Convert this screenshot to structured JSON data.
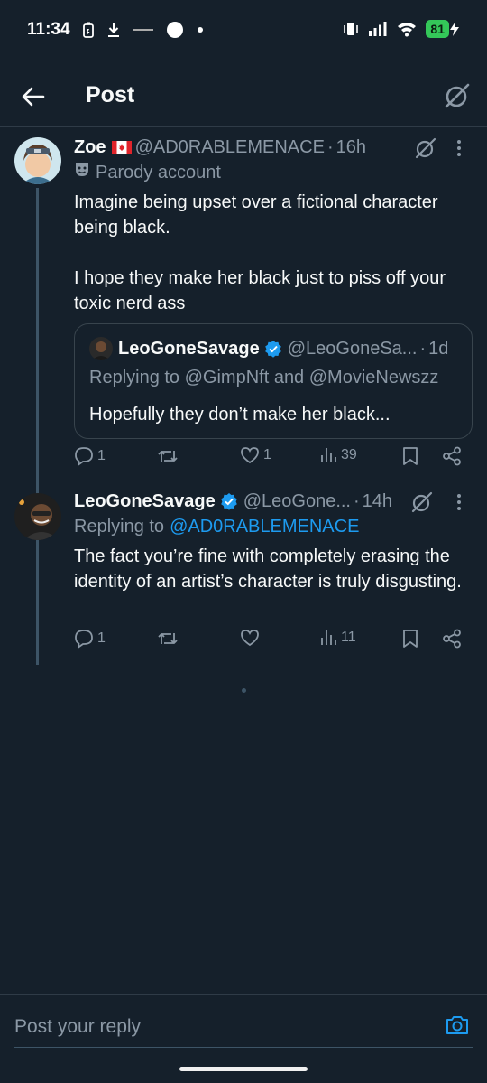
{
  "status_bar": {
    "time": "11:34",
    "battery": "81",
    "icons": [
      "sim-icon",
      "download-icon",
      "app-notification-icon",
      "circle-icon",
      "dot-icon",
      "vibrate-icon",
      "signal-icon",
      "wifi-icon",
      "battery-icon"
    ]
  },
  "header": {
    "title": "Post",
    "back_icon": "arrow-left-icon",
    "action_icon": "grok-icon"
  },
  "tweets": [
    {
      "display_name": "Zoe",
      "flag": "🇨🇦",
      "handle": "@AD0RABLEMENACE",
      "time": "16h",
      "sub_label": "Parody account",
      "text": "Imagine being upset over a fictional character being black.\n\nI hope they make her black just to piss off your toxic nerd ass",
      "quote": {
        "display_name": "LeoGoneSavage",
        "handle": "@LeoGoneSa...",
        "time": "1d",
        "replying_to": "Replying to @GimpNft and @MovieNewszz",
        "text": "Hopefully they don’t make her black..."
      },
      "actions": {
        "replies": "1",
        "reposts": "",
        "likes": "1",
        "views": "39"
      }
    },
    {
      "display_name": "LeoGoneSavage",
      "handle": "@LeoGone...",
      "time": "14h",
      "replying_prefix": "Replying to",
      "replying_to": "@AD0RABLEMENACE",
      "text": "The fact you’re fine with completely erasing the identity of an artist’s character is truly disgusting.",
      "actions": {
        "replies": "1",
        "reposts": "",
        "likes": "",
        "views": "11"
      }
    }
  ],
  "composer": {
    "placeholder": "Post your reply"
  },
  "colors": {
    "background": "#15202b",
    "accent": "#1d9bf0",
    "muted": "#8b98a5",
    "battery": "#34c759"
  }
}
